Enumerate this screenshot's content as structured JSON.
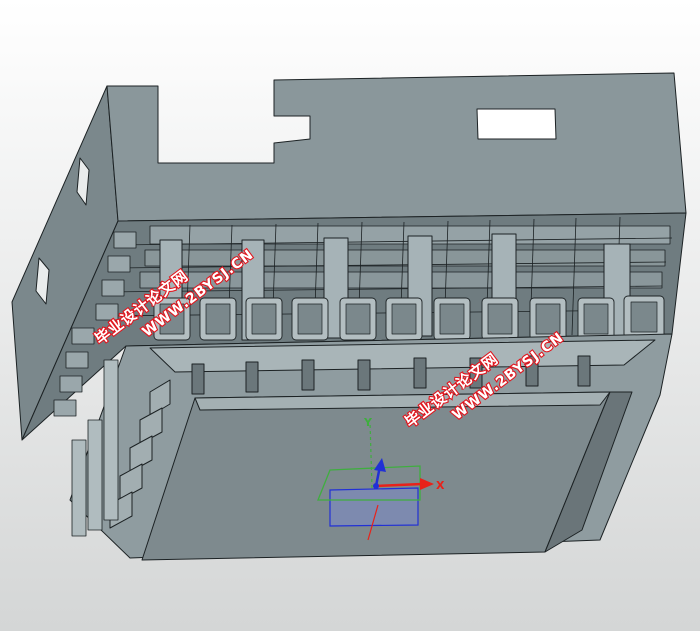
{
  "viewport": {
    "background_top": "#ffffff",
    "background_bottom": "#d4d6d6"
  },
  "model": {
    "face_main": "#8a979b",
    "face_light": "#a6b3b7",
    "face_dark": "#5f6b6f",
    "edge": "#1c2224",
    "inner": "#7b888c"
  },
  "watermarks": [
    {
      "cn": "毕业设计论文网",
      "url": "WWW.2BYSJ.CN"
    },
    {
      "cn": "毕业设计论文网",
      "url": "WWW.2BYSJ.CN"
    }
  ],
  "triad": {
    "x_label": "X",
    "y_label": "Y",
    "x_color": "#e8221a",
    "y_color": "#3fae3f",
    "z_color": "#2130d6"
  }
}
